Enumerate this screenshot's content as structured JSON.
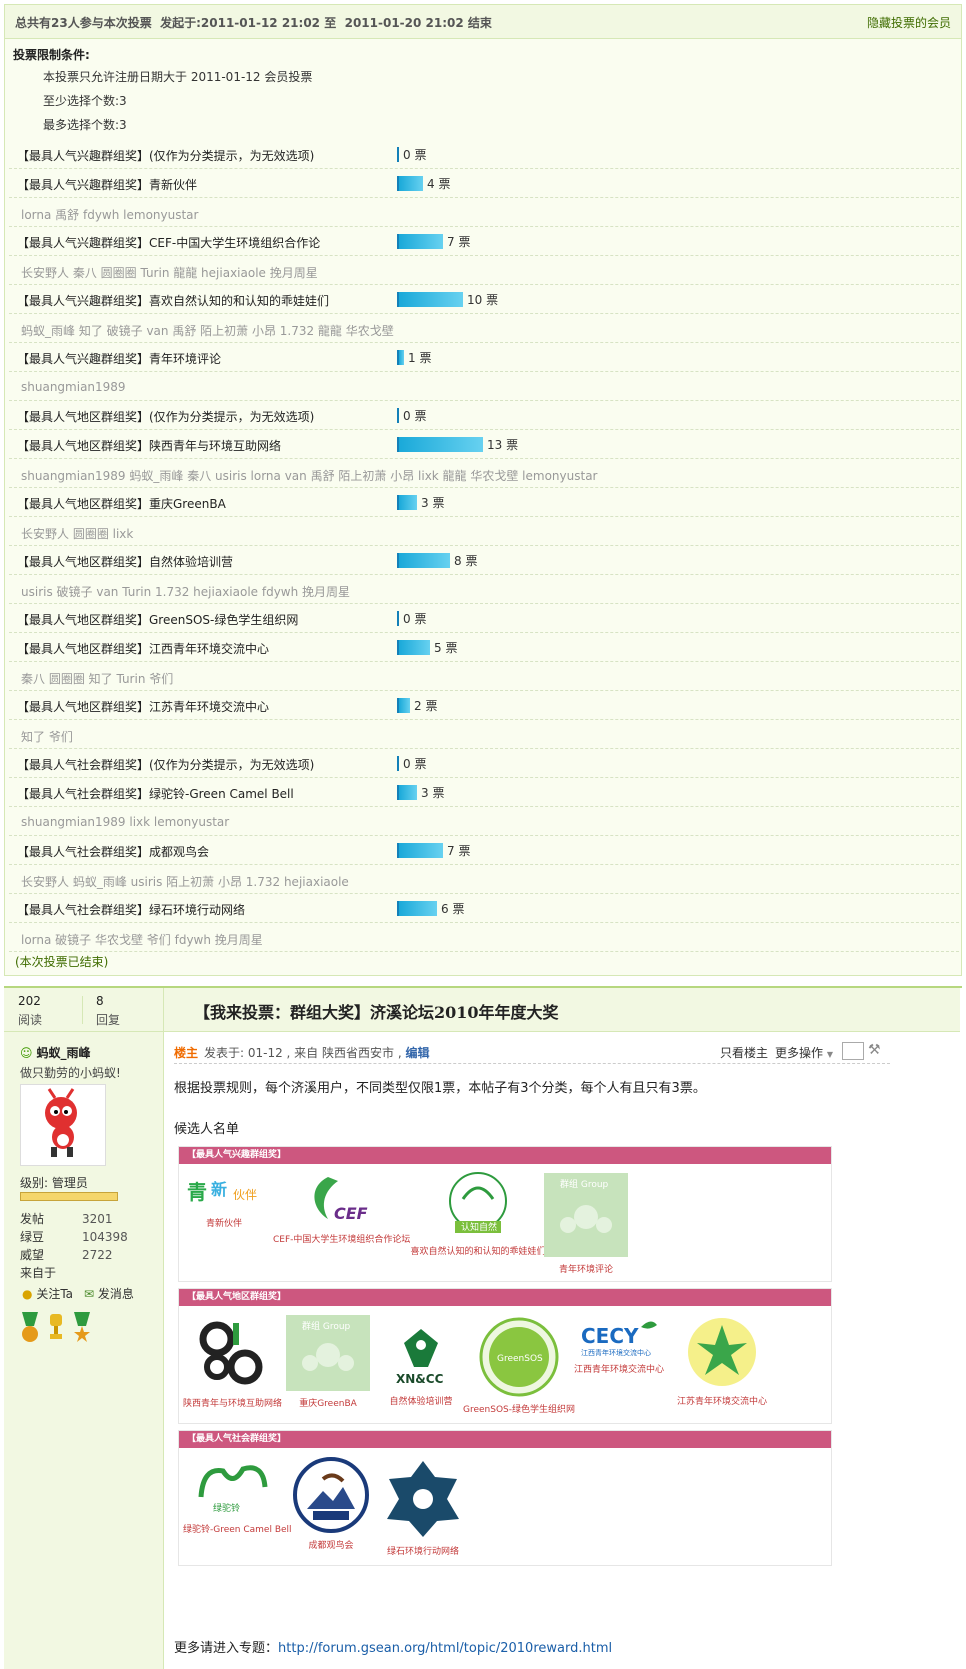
{
  "poll": {
    "summary_prefix": "总共有",
    "participants": "23人参与本次投票",
    "start_label": "发起于:",
    "start": "2011-01-12 21:02",
    "to_label": "至",
    "end": "2011-01-20 21:02",
    "end_label": "结束",
    "hide_voters_label": "隐藏投票的会员",
    "limits_title": "投票限制条件:",
    "limit_reg": "本投票只允许注册日期大于  2011-01-12 会员投票",
    "limit_min": "至少选择个数:3",
    "limit_max": "最多选择个数:3",
    "ended_label": "(本次投票已结束)",
    "options": [
      {
        "label": "【最具人气兴趣群组奖】(仅作为分类提示，为无效选项)",
        "votes": 0,
        "count_label": "0 票",
        "voters": null
      },
      {
        "label": "【最具人气兴趣群组奖】青新伙伴",
        "votes": 4,
        "count_label": "4 票",
        "voters": "lorna 禹舒  fdywh lemonyustar"
      },
      {
        "label": "【最具人气兴趣群组奖】CEF-中国大学生环境组织合作论",
        "votes": 7,
        "count_label": "7 票",
        "voters": "长安野人  秦八  圆圈圈  Turin 龍龍  hejiaxiaole 挽月周星"
      },
      {
        "label": "【最具人气兴趣群组奖】喜欢自然认知的和认知的乖娃娃们",
        "votes": 10,
        "count_label": "10 票",
        "voters": "蚂蚁_雨峰  知了  破镜子  van 禹舒  陌上初萧  小昂  1.732 龍龍  华农戈壁"
      },
      {
        "label": "【最具人气兴趣群组奖】青年环境评论",
        "votes": 1,
        "count_label": "1 票",
        "voters": "shuangmian1989"
      },
      {
        "label": "【最具人气地区群组奖】(仅作为分类提示，为无效选项)",
        "votes": 0,
        "count_label": "0 票",
        "voters": null
      },
      {
        "label": "【最具人气地区群组奖】陕西青年与环境互助网络",
        "votes": 13,
        "count_label": "13 票",
        "voters": "shuangmian1989 蚂蚁_雨峰  秦八  usiris lorna van 禹舒  陌上初萧  小昂  lixk 龍龍  华农戈壁  lemonyustar"
      },
      {
        "label": "【最具人气地区群组奖】重庆GreenBA",
        "votes": 3,
        "count_label": "3 票",
        "voters": "长安野人  圆圈圈  lixk"
      },
      {
        "label": "【最具人气地区群组奖】自然体验培训营",
        "votes": 8,
        "count_label": "8 票",
        "voters": "usiris 破镜子  van Turin 1.732 hejiaxiaole fdywh 挽月周星"
      },
      {
        "label": "【最具人气地区群组奖】GreenSOS-绿色学生组织网",
        "votes": 0,
        "count_label": "0 票",
        "voters": null
      },
      {
        "label": "【最具人气地区群组奖】江西青年环境交流中心",
        "votes": 5,
        "count_label": "5 票",
        "voters": "秦八  圆圈圈  知了  Turin 爷们"
      },
      {
        "label": "【最具人气地区群组奖】江苏青年环境交流中心",
        "votes": 2,
        "count_label": "2 票",
        "voters": "知了  爷们"
      },
      {
        "label": "【最具人气社会群组奖】(仅作为分类提示，为无效选项)",
        "votes": 0,
        "count_label": "0 票",
        "voters": null
      },
      {
        "label": "【最具人气社会群组奖】绿驼铃-Green Camel Bell",
        "votes": 3,
        "count_label": "3 票",
        "voters": "shuangmian1989 lixk lemonyustar"
      },
      {
        "label": "【最具人气社会群组奖】成都观鸟会",
        "votes": 7,
        "count_label": "7 票",
        "voters": "长安野人  蚂蚁_雨峰  usiris 陌上初萧  小昂  1.732 hejiaxiaole"
      },
      {
        "label": "【最具人气社会群组奖】绿石环境行动网络",
        "votes": 6,
        "count_label": "6 票",
        "voters": "lorna 破镜子  华农戈壁  爷们  fdywh 挽月周星"
      }
    ]
  },
  "thread": {
    "views": "202",
    "views_label": "阅读",
    "replies": "8",
    "replies_label": "回复",
    "title": "【我来投票：群组大奖】济溪论坛2010年年度大奖"
  },
  "author": {
    "name": "蚂蚁_雨峰",
    "signature": "做只勤劳的小蚂蚁!",
    "rank": "级别: 管理员",
    "posts_label": "发帖",
    "posts": "3201",
    "beans_label": "绿豆",
    "beans": "104398",
    "prestige_label": "威望",
    "prestige": "2722",
    "from_label": "来自于",
    "follow_label": "关注Ta",
    "message_label": "发消息"
  },
  "post": {
    "owner_tag": "楼主",
    "meta": "发表于: 01-12 , 来自 陕西省西安市 ,",
    "edit_label": "编辑",
    "only_op": "只看楼主",
    "more_ops": "更多操作",
    "rules": "根据投票规则，每个济溪用户，不同类型仅限1票，本帖子有3个分类，每个人有且只有3票。",
    "candidates_title": "候选人名单",
    "categories": [
      {
        "head": "【最具人气兴趣群组奖】",
        "logos": [
          "青新伙伴",
          "CEF-中国大学生环境组织合作论坛",
          "喜欢自然认知的和认知的乖娃娃们",
          "青年环境评论"
        ]
      },
      {
        "head": "【最具人气地区群组奖】",
        "logos": [
          "陕西青年与环境互助网络",
          "重庆GreenBA",
          "自然体验培训营",
          "GreenSOS-绿色学生组织网",
          "江西青年环境交流中心",
          "江苏青年环境交流中心"
        ]
      },
      {
        "head": "【最具人气社会群组奖】",
        "logos": [
          "绿驼铃-Green Camel Bell",
          "成都观鸟会",
          "绿石环境行动网络"
        ]
      }
    ],
    "more_topic_label": "更多请进入专题：",
    "more_topic_url": "http://forum.gsean.org/html/topic/2010reward.html"
  },
  "colors": {
    "bar": "#1aa9d9",
    "header_bg": "#f2f8e2",
    "accent_green": "#3f6c00",
    "category_head": "#cd577f"
  }
}
